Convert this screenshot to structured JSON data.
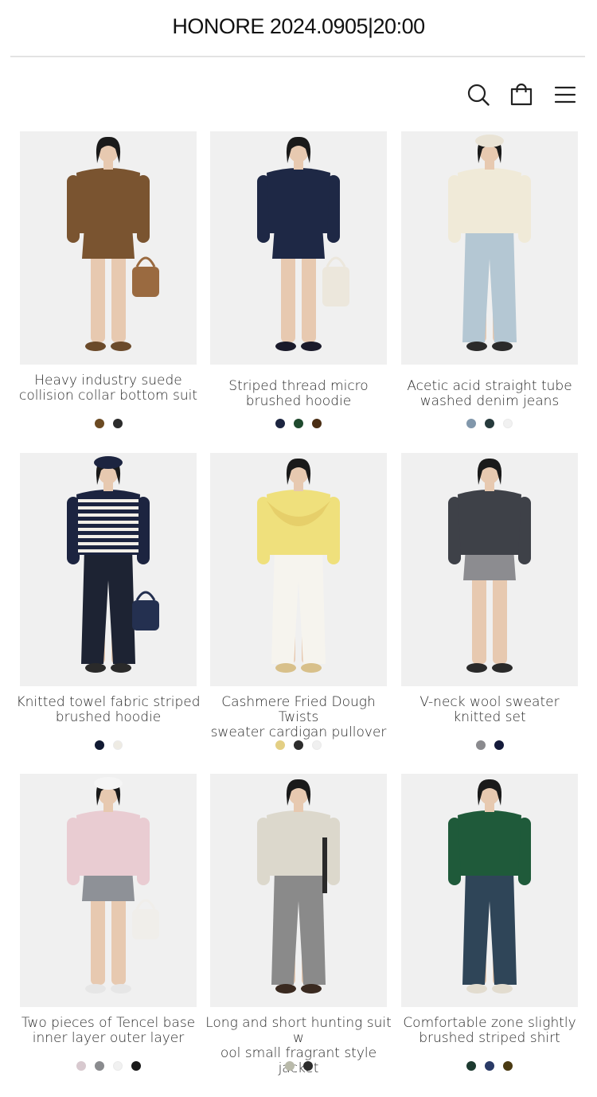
{
  "banner": {
    "text": "HONORE 2024.0905|20:00"
  },
  "toolbar": {
    "icons": [
      "search-icon",
      "shopping-bag-icon",
      "menu-icon"
    ],
    "icon_color": "#222222"
  },
  "products": [
    {
      "name": "Heavy industry suede\ncollision collar bottom suit",
      "swatches": [
        "#6b4a22",
        "#2c2c2c"
      ],
      "outfit": {
        "top": "#7a5430",
        "bottom": "#7a5430",
        "acc": "#9a6a40",
        "shoes": "#6b4a2a",
        "hat": ""
      }
    },
    {
      "name": "Striped thread micro\nbrushed hoodie",
      "swatches": [
        "#1c2540",
        "#1f4a2e",
        "#4a2e14"
      ],
      "outfit": {
        "top": "#1e2845",
        "bottom": "#1e2845",
        "acc": "#ece7dc",
        "shoes": "#1a1a2a",
        "hat": ""
      }
    },
    {
      "name": "Acetic acid straight tube\nwashed denim jeans",
      "swatches": [
        "#8197ab",
        "#263a3c",
        "#f1f1f1"
      ],
      "outfit": {
        "top": "#f0ead8",
        "bottom": "#b4c7d3",
        "acc": "",
        "shoes": "#2a2a2a",
        "hat": "#e9e3d5"
      }
    },
    {
      "name": "Knitted towel fabric striped\nbrushed hoodie",
      "swatches": [
        "#111a33",
        "#eeebe3"
      ],
      "outfit": {
        "top": "#1c2440",
        "bottom": "#1d2333",
        "acc": "#243050",
        "shoes": "#2a2a2a",
        "hat": "#1c2440"
      }
    },
    {
      "name": "Cashmere Fried Dough Twists\nsweater cardigan pullover",
      "swatches": [
        "#e3cf84",
        "#2c2c2c",
        "#f0f0f0"
      ],
      "outfit": {
        "top": "#efe07c",
        "bottom": "#f6f4ee",
        "acc": "#e6cf6a",
        "shoes": "#d8c08a",
        "hat": ""
      }
    },
    {
      "name": "V-neck wool sweater\nknitted set",
      "swatches": [
        "#8a8a8e",
        "#141a3a"
      ],
      "outfit": {
        "top": "#3e4148",
        "bottom": "#8c8c90",
        "acc": "",
        "shoes": "#2a2a2a",
        "hat": ""
      }
    },
    {
      "name": "Two pieces of Tencel base\ninner layer outer layer",
      "swatches": [
        "#d8c9cf",
        "#8a8b8e",
        "#f1f1f1",
        "#1a1a1a"
      ],
      "outfit": {
        "top": "#e9ccd2",
        "bottom": "#8e9197",
        "acc": "#f0eeea",
        "shoes": "#e6e6e6",
        "hat": "#f5f5f5"
      }
    },
    {
      "name": "Long and short hunting suit w\nool small fragrant style jacket",
      "swatches": [
        "#b9baaa",
        "#2c2c2c"
      ],
      "outfit": {
        "top": "#dcd8cc",
        "bottom": "#8a8a8a",
        "acc": "#2a2a2a",
        "shoes": "#3a2a20",
        "hat": ""
      }
    },
    {
      "name": "Comfortable zone slightly\nbrushed striped shirt",
      "swatches": [
        "#1d3a30",
        "#2a3a66",
        "#4a3a12"
      ],
      "outfit": {
        "top": "#1f5a3a",
        "bottom": "#2f4558",
        "acc": "",
        "shoes": "#e2dccf",
        "hat": ""
      }
    }
  ]
}
